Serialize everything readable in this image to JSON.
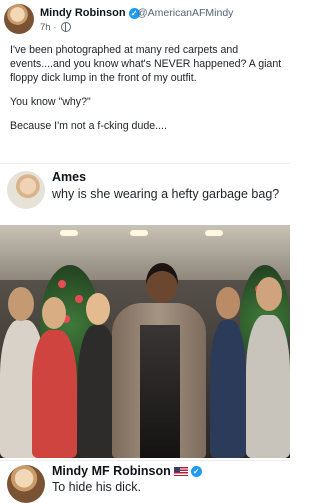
{
  "top_tweet": {
    "display_name": "Mindy Robinson",
    "handle": "@AmericanAFMindy",
    "time": "7h",
    "separator": "·",
    "paragraphs": [
      "I've been photographed at many red carpets and events....and you know what's NEVER happened? A giant floppy dick lump in the front of my outfit.",
      "You know \"why?\"",
      "Because I'm not a f-cking dude...."
    ]
  },
  "reply_ames": {
    "display_name": "Ames",
    "text": "why is she wearing a hefty garbage bag?"
  },
  "reply_mindy": {
    "display_name": "Mindy MF Robinson",
    "text": "To hide his dick."
  },
  "icons": {
    "verified": "verified-badge-icon",
    "globe": "globe-icon",
    "flag": "us-flag-icon"
  },
  "colors": {
    "verified_blue": "#1d9bf0",
    "secondary_text": "#536471",
    "primary_text": "#0f1419"
  }
}
